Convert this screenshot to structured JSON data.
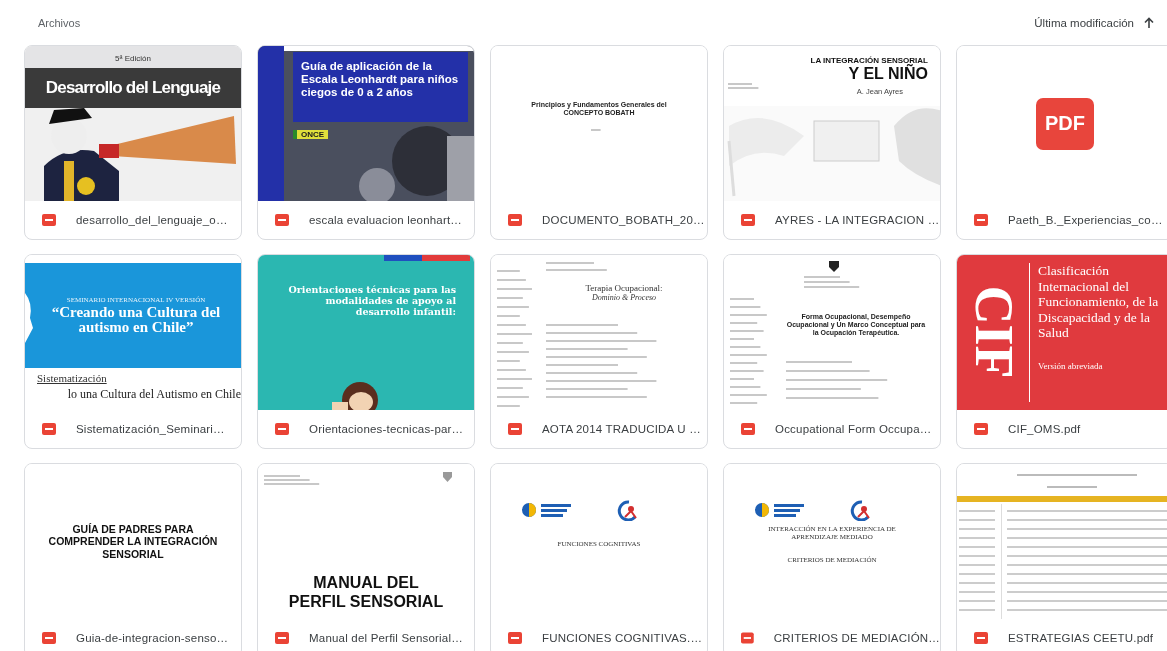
{
  "header": {
    "title": "Archivos",
    "sort_label": "Última modificación"
  },
  "files": [
    {
      "name": "desarrollo_del_lenguaje_o…",
      "thumbnail": {
        "kind": "banner_photo",
        "texts": [
          "5ª Edición",
          "Desarrollo del Lenguaje"
        ]
      }
    },
    {
      "name": "escala evaluacion leonhart…",
      "thumbnail": {
        "kind": "blue_cover",
        "texts": [
          "Guía de aplicación de la Escala Leonhardt para niños ciegos de 0 a 2 años",
          "ONCE"
        ]
      }
    },
    {
      "name": "DOCUMENTO_BOBATH_20…",
      "thumbnail": {
        "kind": "doc",
        "texts": [
          "Principios y Fundamentos Generales del CONCEPTO BOBATH"
        ]
      }
    },
    {
      "name": "AYRES - LA INTEGRACION …",
      "thumbnail": {
        "kind": "ayres",
        "texts": [
          "LA INTEGRACIÓN SENSORIAL",
          "Y EL NIÑO",
          "A. Jean Ayres"
        ]
      }
    },
    {
      "name": "Paeth_B._Experiencias_co…",
      "thumbnail": {
        "kind": "pdf",
        "texts": [
          "PDF"
        ]
      }
    },
    {
      "name": "Sistematización_Seminari…",
      "thumbnail": {
        "kind": "seminar",
        "texts": [
          "SEMINARIO INTERNACIONAL IV VERSIÓN",
          "“Creando una Cultura del autismo en Chile”",
          "Sistematización",
          "lo una Cultura del Autismo en Chile"
        ]
      }
    },
    {
      "name": "Orientaciones-tecnicas-par…",
      "thumbnail": {
        "kind": "teal",
        "texts": [
          "Orientaciones técnicas para las modalidades de apoyo al desarrollo infantil:"
        ]
      }
    },
    {
      "name": "AOTA 2014 TRADUCIDA U …",
      "thumbnail": {
        "kind": "aota",
        "texts": [
          "Terapia Ocupacional:",
          "Dominio & Proceso"
        ]
      }
    },
    {
      "name": "Occupational Form Occupa…",
      "thumbnail": {
        "kind": "occ",
        "texts": [
          "Forma Ocupacional, Desempeño Ocupacional y Un Marco Conceptual para la Ocupación Terapéutica."
        ]
      }
    },
    {
      "name": "CIF_OMS.pdf",
      "thumbnail": {
        "kind": "cif",
        "texts": [
          "CIF",
          "Clasificación Internacional del Funcionamiento, de la Discapacidad y de la Salud",
          "Versión abreviada"
        ]
      }
    },
    {
      "name": "Guia-de-integracion-senso…",
      "thumbnail": {
        "kind": "title_small",
        "texts": [
          "GUÍA DE PADRES PARA COMPRENDER LA INTEGRACIÓN SENSORIAL"
        ]
      }
    },
    {
      "name": "Manual del Perfil Sensorial…",
      "thumbnail": {
        "kind": "title_large",
        "texts": [
          "MANUAL DEL PERFIL SENSORIAL"
        ]
      }
    },
    {
      "name": "FUNCIONES COGNITIVAS.…",
      "thumbnail": {
        "kind": "logos_doc",
        "texts": [
          "FUNCIONES COGNITIVAS"
        ]
      }
    },
    {
      "name": "CRITERIOS DE MEDIACIÓN…",
      "thumbnail": {
        "kind": "logos_doc",
        "texts": [
          "INTERACCIÓN EN LA EXPERIENCIA DE APRENDIZAJE MEDIADO",
          "CRITERIOS DE MEDIACIÓN"
        ]
      }
    },
    {
      "name": "ESTRATEGIAS CEETU.pdf",
      "thumbnail": {
        "kind": "table_doc"
      }
    }
  ]
}
